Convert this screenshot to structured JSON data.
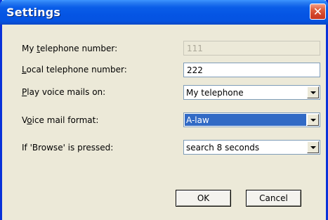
{
  "window": {
    "title": "Settings",
    "close_glyph": "✕"
  },
  "rows": [
    {
      "label_pre": "My ",
      "label_ul": "t",
      "label_post": "elephone number:",
      "value": "111",
      "type": "text",
      "disabled": true
    },
    {
      "label_pre": "",
      "label_ul": "L",
      "label_post": "ocal telephone number:",
      "value": "222",
      "type": "text",
      "disabled": false
    },
    {
      "label_pre": "",
      "label_ul": "P",
      "label_post": "lay voice mails on:",
      "value": "My telephone",
      "type": "select"
    },
    {
      "label_pre": "V",
      "label_ul": "o",
      "label_post": "ice mail format:",
      "value": "A-law",
      "type": "select",
      "highlighted": true
    },
    {
      "label_pre": "If 'Browse' is pressed:",
      "label_ul": "",
      "label_post": "",
      "value": "search 8 seconds",
      "type": "select"
    }
  ],
  "buttons": {
    "ok_label": "OK",
    "cancel_label": "Cancel"
  },
  "colors": {
    "titlebar": "#0555e4",
    "close": "#d2442a",
    "selection": "#316ac5",
    "face": "#ece9d8"
  }
}
